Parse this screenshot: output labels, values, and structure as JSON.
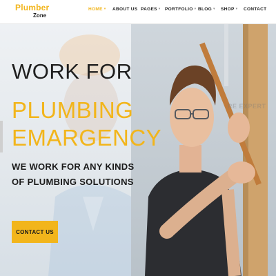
{
  "header": {
    "logo_main": "Plumber",
    "logo_sub": "Zone"
  },
  "nav": {
    "items": [
      {
        "label": "HOME",
        "has_caret": true,
        "active": true
      },
      {
        "label": "ABOUT US",
        "has_caret": false,
        "active": false
      },
      {
        "label": "PAGES",
        "has_caret": true,
        "active": false
      },
      {
        "label": "PORTFOLIO",
        "has_caret": true,
        "active": false
      },
      {
        "label": "BLOG",
        "has_caret": true,
        "active": false
      },
      {
        "label": "SHOP",
        "has_caret": true,
        "active": false
      },
      {
        "label": "CONTACT",
        "has_caret": false,
        "active": false
      }
    ],
    "caret_glyph": "▾"
  },
  "hero": {
    "title_line1": "WORK FOR",
    "title_line2": "PLUMBING",
    "title_line3": "EMARGENCY",
    "subtitle": "WE WORK FOR ANY KINDS OF PLUMBING SOLUTIONS",
    "cta_label": "CONTACT US",
    "watermark": "RE EXPERT"
  },
  "colors": {
    "accent": "#f2b51b",
    "text_dark": "#1f1f1f"
  }
}
